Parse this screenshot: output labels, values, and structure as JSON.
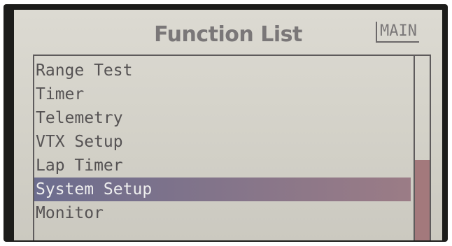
{
  "screen": {
    "title": "Function List",
    "mode_tag": "MAIN"
  },
  "menu": {
    "items": [
      {
        "label": "Range Test"
      },
      {
        "label": "Timer"
      },
      {
        "label": "Telemetry"
      },
      {
        "label": "VTX Setup"
      },
      {
        "label": "Lap Timer"
      },
      {
        "label": "System Setup"
      },
      {
        "label": "Monitor"
      }
    ],
    "selected_index": 5
  },
  "scrollbar": {
    "position_fraction": 0.56,
    "thumb_fraction": 0.44
  },
  "colors": {
    "highlight_start": "#6c6d8e",
    "highlight_end": "#9b7c86",
    "scroll_thumb": "#a3797c",
    "lcd_background": "#d4d2c9",
    "text": "#555253"
  }
}
